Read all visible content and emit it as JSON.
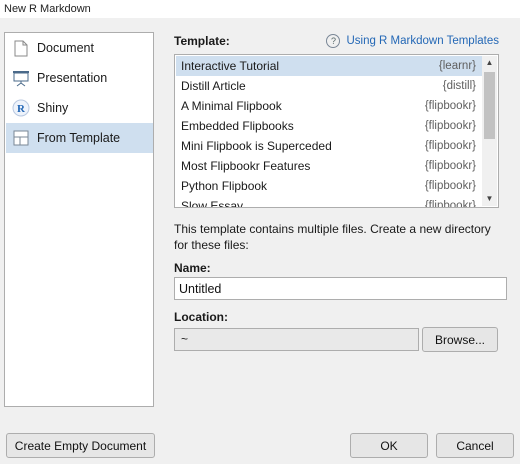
{
  "window": {
    "title": "New R Markdown"
  },
  "sidebar": {
    "items": [
      {
        "label": "Document",
        "icon": "document-icon",
        "selected": false
      },
      {
        "label": "Presentation",
        "icon": "presentation-icon",
        "selected": false
      },
      {
        "label": "Shiny",
        "icon": "shiny-r-icon",
        "selected": false
      },
      {
        "label": "From Template",
        "icon": "template-icon",
        "selected": true
      }
    ]
  },
  "template": {
    "heading": "Template:",
    "help_link": "Using R Markdown Templates",
    "help_icon": "help-icon",
    "items": [
      {
        "name": "Interactive Tutorial",
        "package": "{learnr}",
        "selected": true
      },
      {
        "name": "Distill Article",
        "package": "{distill}",
        "selected": false
      },
      {
        "name": "A Minimal Flipbook",
        "package": "{flipbookr}",
        "selected": false
      },
      {
        "name": "Embedded Flipbooks",
        "package": "{flipbookr}",
        "selected": false
      },
      {
        "name": "Mini Flipbook is Superceded",
        "package": "{flipbookr}",
        "selected": false
      },
      {
        "name": "Most Flipbookr Features",
        "package": "{flipbookr}",
        "selected": false
      },
      {
        "name": "Python Flipbook",
        "package": "{flipbookr}",
        "selected": false
      },
      {
        "name": "Slow Essay",
        "package": "{flipbookr}",
        "selected": false
      }
    ]
  },
  "description": "This template contains multiple files. Create a new directory for these files:",
  "name_field": {
    "label": "Name:",
    "value": "Untitled"
  },
  "location_field": {
    "label": "Location:",
    "value": "~"
  },
  "buttons": {
    "browse": "Browse...",
    "create_empty": "Create Empty Document",
    "ok": "OK",
    "cancel": "Cancel"
  },
  "colors": {
    "selection": "#cfdfef",
    "link": "#2468b6"
  }
}
